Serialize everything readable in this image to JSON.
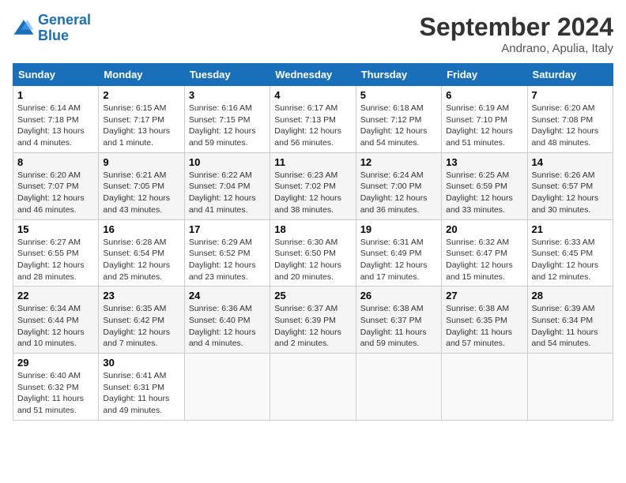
{
  "header": {
    "logo_general": "General",
    "logo_blue": "Blue",
    "month_title": "September 2024",
    "location": "Andrano, Apulia, Italy"
  },
  "columns": [
    "Sunday",
    "Monday",
    "Tuesday",
    "Wednesday",
    "Thursday",
    "Friday",
    "Saturday"
  ],
  "weeks": [
    [
      {
        "day": "1",
        "sunrise": "Sunrise: 6:14 AM",
        "sunset": "Sunset: 7:18 PM",
        "daylight": "Daylight: 13 hours and 4 minutes."
      },
      {
        "day": "2",
        "sunrise": "Sunrise: 6:15 AM",
        "sunset": "Sunset: 7:17 PM",
        "daylight": "Daylight: 13 hours and 1 minute."
      },
      {
        "day": "3",
        "sunrise": "Sunrise: 6:16 AM",
        "sunset": "Sunset: 7:15 PM",
        "daylight": "Daylight: 12 hours and 59 minutes."
      },
      {
        "day": "4",
        "sunrise": "Sunrise: 6:17 AM",
        "sunset": "Sunset: 7:13 PM",
        "daylight": "Daylight: 12 hours and 56 minutes."
      },
      {
        "day": "5",
        "sunrise": "Sunrise: 6:18 AM",
        "sunset": "Sunset: 7:12 PM",
        "daylight": "Daylight: 12 hours and 54 minutes."
      },
      {
        "day": "6",
        "sunrise": "Sunrise: 6:19 AM",
        "sunset": "Sunset: 7:10 PM",
        "daylight": "Daylight: 12 hours and 51 minutes."
      },
      {
        "day": "7",
        "sunrise": "Sunrise: 6:20 AM",
        "sunset": "Sunset: 7:08 PM",
        "daylight": "Daylight: 12 hours and 48 minutes."
      }
    ],
    [
      {
        "day": "8",
        "sunrise": "Sunrise: 6:20 AM",
        "sunset": "Sunset: 7:07 PM",
        "daylight": "Daylight: 12 hours and 46 minutes."
      },
      {
        "day": "9",
        "sunrise": "Sunrise: 6:21 AM",
        "sunset": "Sunset: 7:05 PM",
        "daylight": "Daylight: 12 hours and 43 minutes."
      },
      {
        "day": "10",
        "sunrise": "Sunrise: 6:22 AM",
        "sunset": "Sunset: 7:04 PM",
        "daylight": "Daylight: 12 hours and 41 minutes."
      },
      {
        "day": "11",
        "sunrise": "Sunrise: 6:23 AM",
        "sunset": "Sunset: 7:02 PM",
        "daylight": "Daylight: 12 hours and 38 minutes."
      },
      {
        "day": "12",
        "sunrise": "Sunrise: 6:24 AM",
        "sunset": "Sunset: 7:00 PM",
        "daylight": "Daylight: 12 hours and 36 minutes."
      },
      {
        "day": "13",
        "sunrise": "Sunrise: 6:25 AM",
        "sunset": "Sunset: 6:59 PM",
        "daylight": "Daylight: 12 hours and 33 minutes."
      },
      {
        "day": "14",
        "sunrise": "Sunrise: 6:26 AM",
        "sunset": "Sunset: 6:57 PM",
        "daylight": "Daylight: 12 hours and 30 minutes."
      }
    ],
    [
      {
        "day": "15",
        "sunrise": "Sunrise: 6:27 AM",
        "sunset": "Sunset: 6:55 PM",
        "daylight": "Daylight: 12 hours and 28 minutes."
      },
      {
        "day": "16",
        "sunrise": "Sunrise: 6:28 AM",
        "sunset": "Sunset: 6:54 PM",
        "daylight": "Daylight: 12 hours and 25 minutes."
      },
      {
        "day": "17",
        "sunrise": "Sunrise: 6:29 AM",
        "sunset": "Sunset: 6:52 PM",
        "daylight": "Daylight: 12 hours and 23 minutes."
      },
      {
        "day": "18",
        "sunrise": "Sunrise: 6:30 AM",
        "sunset": "Sunset: 6:50 PM",
        "daylight": "Daylight: 12 hours and 20 minutes."
      },
      {
        "day": "19",
        "sunrise": "Sunrise: 6:31 AM",
        "sunset": "Sunset: 6:49 PM",
        "daylight": "Daylight: 12 hours and 17 minutes."
      },
      {
        "day": "20",
        "sunrise": "Sunrise: 6:32 AM",
        "sunset": "Sunset: 6:47 PM",
        "daylight": "Daylight: 12 hours and 15 minutes."
      },
      {
        "day": "21",
        "sunrise": "Sunrise: 6:33 AM",
        "sunset": "Sunset: 6:45 PM",
        "daylight": "Daylight: 12 hours and 12 minutes."
      }
    ],
    [
      {
        "day": "22",
        "sunrise": "Sunrise: 6:34 AM",
        "sunset": "Sunset: 6:44 PM",
        "daylight": "Daylight: 12 hours and 10 minutes."
      },
      {
        "day": "23",
        "sunrise": "Sunrise: 6:35 AM",
        "sunset": "Sunset: 6:42 PM",
        "daylight": "Daylight: 12 hours and 7 minutes."
      },
      {
        "day": "24",
        "sunrise": "Sunrise: 6:36 AM",
        "sunset": "Sunset: 6:40 PM",
        "daylight": "Daylight: 12 hours and 4 minutes."
      },
      {
        "day": "25",
        "sunrise": "Sunrise: 6:37 AM",
        "sunset": "Sunset: 6:39 PM",
        "daylight": "Daylight: 12 hours and 2 minutes."
      },
      {
        "day": "26",
        "sunrise": "Sunrise: 6:38 AM",
        "sunset": "Sunset: 6:37 PM",
        "daylight": "Daylight: 11 hours and 59 minutes."
      },
      {
        "day": "27",
        "sunrise": "Sunrise: 6:38 AM",
        "sunset": "Sunset: 6:35 PM",
        "daylight": "Daylight: 11 hours and 57 minutes."
      },
      {
        "day": "28",
        "sunrise": "Sunrise: 6:39 AM",
        "sunset": "Sunset: 6:34 PM",
        "daylight": "Daylight: 11 hours and 54 minutes."
      }
    ],
    [
      {
        "day": "29",
        "sunrise": "Sunrise: 6:40 AM",
        "sunset": "Sunset: 6:32 PM",
        "daylight": "Daylight: 11 hours and 51 minutes."
      },
      {
        "day": "30",
        "sunrise": "Sunrise: 6:41 AM",
        "sunset": "Sunset: 6:31 PM",
        "daylight": "Daylight: 11 hours and 49 minutes."
      },
      null,
      null,
      null,
      null,
      null
    ]
  ]
}
